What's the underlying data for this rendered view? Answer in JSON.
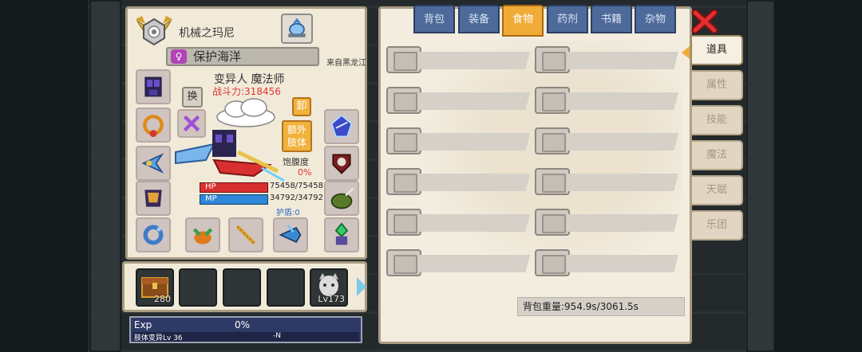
{
  "character": {
    "name": "机械之玛尼",
    "title": "保护海洋",
    "from": "来自黑龙江",
    "race_class": "变异人 魔法师",
    "power": "战斗力:318456",
    "swap_label": "换",
    "unequip_label": "卸",
    "extra_limb_label": "额外\n肢体",
    "satiety_label": "饱腹度",
    "satiety_value": "0%",
    "hp_label": "HP",
    "hp_value": "75458/75458",
    "mp_label": "MP",
    "mp_value": "34792/34792",
    "shield_label": "护盾:0"
  },
  "quickbar": {
    "slot1_label": "280",
    "slot5_label": "Lv173"
  },
  "exp": {
    "label": "Exp",
    "value": "0%",
    "sub_label": "肢体变异Lv 36",
    "sub_value": "-N"
  },
  "inventory": {
    "tabs": [
      {
        "label": "背包",
        "active": false
      },
      {
        "label": "装备",
        "active": false
      },
      {
        "label": "食物",
        "active": true
      },
      {
        "label": "药剂",
        "active": false
      },
      {
        "label": "书籍",
        "active": false
      },
      {
        "label": "杂物",
        "active": false
      }
    ],
    "weight": "背包重量:954.9s/3061.5s"
  },
  "side_tabs": [
    {
      "label": "道具",
      "active": true
    },
    {
      "label": "属性",
      "active": false
    },
    {
      "label": "技能",
      "active": false
    },
    {
      "label": "魔法",
      "active": false
    },
    {
      "label": "天赋",
      "active": false
    },
    {
      "label": "乐团",
      "active": false
    }
  ],
  "colors": {
    "accent_orange": "#f0ac37",
    "tab_blue": "#4e6a9a",
    "hp_red": "#d82f2f",
    "mp_blue": "#2e86d8",
    "power_red": "#e03434"
  }
}
